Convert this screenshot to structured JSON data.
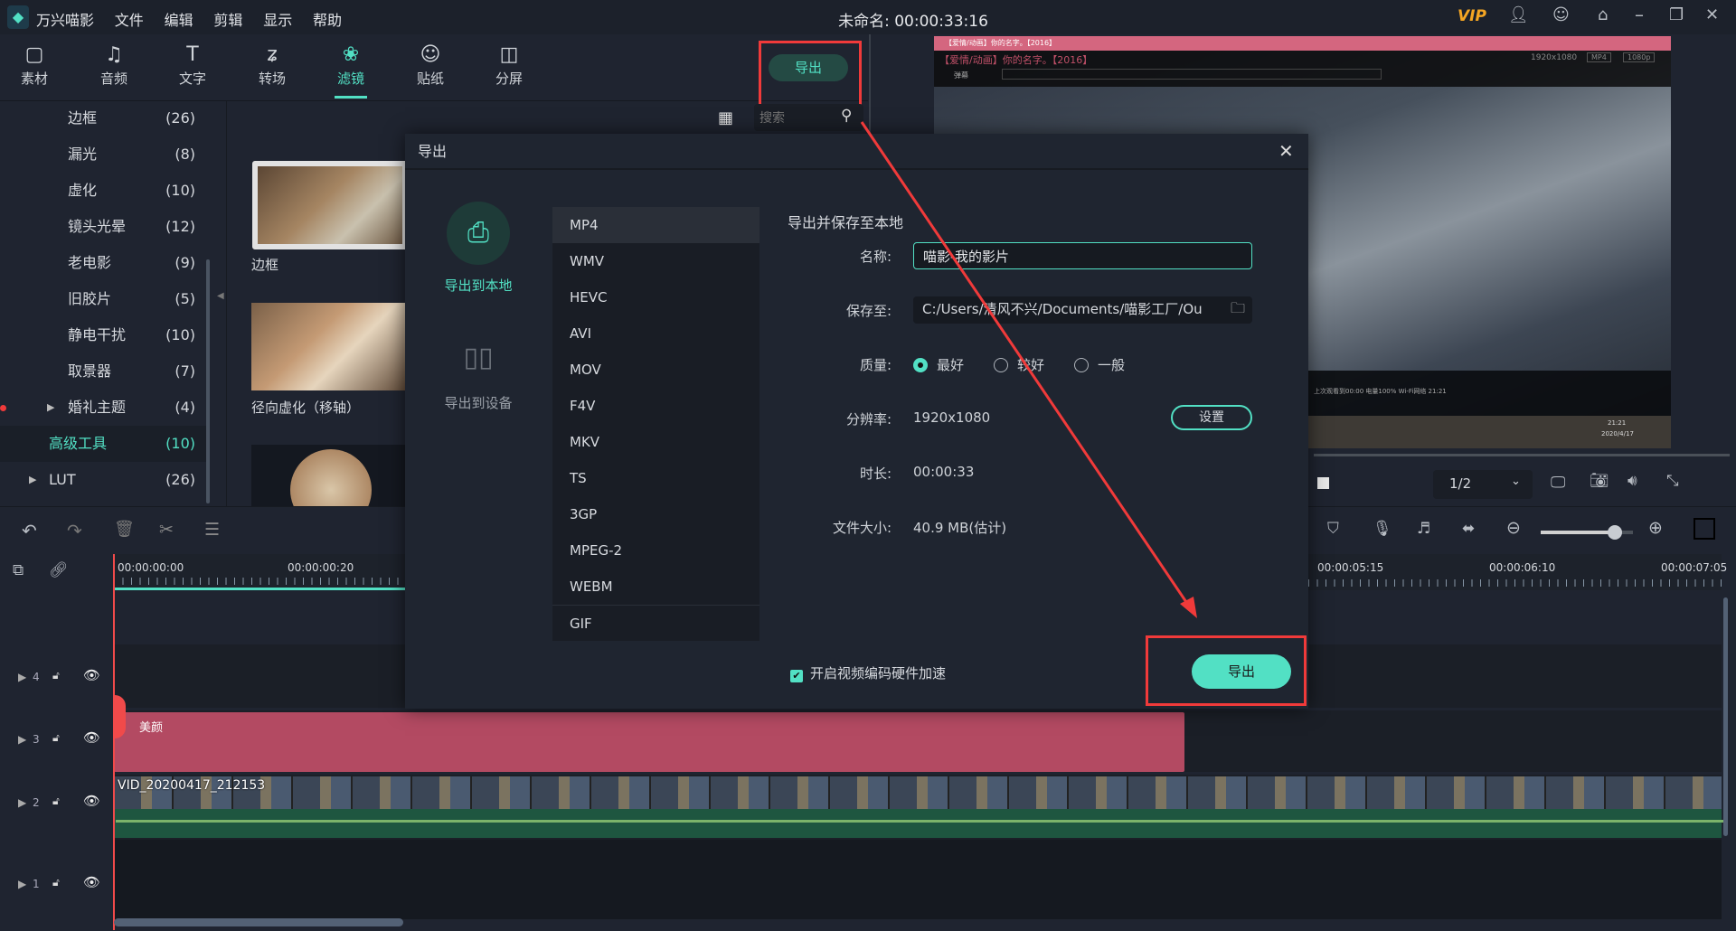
{
  "app": {
    "name": "万兴喵影",
    "menu": [
      "文件",
      "编辑",
      "剪辑",
      "显示",
      "帮助"
    ],
    "title": "未命名: 00:00:33:16",
    "vip": "VIP"
  },
  "tabs": [
    {
      "label": "素材",
      "icon": "media-icon"
    },
    {
      "label": "音频",
      "icon": "music-icon"
    },
    {
      "label": "文字",
      "icon": "text-icon"
    },
    {
      "label": "转场",
      "icon": "transition-icon"
    },
    {
      "label": "滤镜",
      "icon": "filter-icon",
      "active": true
    },
    {
      "label": "贴纸",
      "icon": "sticker-icon"
    },
    {
      "label": "分屏",
      "icon": "splitscreen-icon"
    }
  ],
  "export_top": "导出",
  "search": {
    "placeholder": "搜索"
  },
  "categories": [
    {
      "name": "边框",
      "count": "(26)"
    },
    {
      "name": "漏光",
      "count": "(8)"
    },
    {
      "name": "虚化",
      "count": "(10)"
    },
    {
      "name": "镜头光晕",
      "count": "(12)"
    },
    {
      "name": "老电影",
      "count": "(9)"
    },
    {
      "name": "旧胶片",
      "count": "(5)"
    },
    {
      "name": "静电干扰",
      "count": "(10)"
    },
    {
      "name": "取景器",
      "count": "(7)"
    },
    {
      "name": "婚礼主题",
      "count": "(4)",
      "expandable": true
    },
    {
      "name": "高级工具",
      "count": "(10)",
      "selected": true
    },
    {
      "name": "LUT",
      "count": "(26)",
      "expandable": true
    }
  ],
  "thumbs": [
    {
      "label": "边框"
    },
    {
      "label": "径向虚化（移轴）"
    }
  ],
  "preview": {
    "video_title": "【爱情/动画】你的名字。【2016】",
    "resolution": "1920x1080",
    "format": "MP4",
    "quality": "1080p",
    "danmaku": "弹幕",
    "status": "上次观看到00:00 电量100% Wi-Fi网络 21:21",
    "clock_time": "21:21",
    "clock_date": "2020/4/17",
    "page": "1/2"
  },
  "dialog": {
    "title": "导出",
    "targets": [
      {
        "label": "导出到本地",
        "active": true
      },
      {
        "label": "导出到设备"
      }
    ],
    "formats": [
      "MP4",
      "WMV",
      "HEVC",
      "AVI",
      "MOV",
      "F4V",
      "MKV",
      "TS",
      "3GP",
      "MPEG-2",
      "WEBM",
      "GIF"
    ],
    "selected_format": "MP4",
    "heading": "导出并保存至本地",
    "name_label": "名称:",
    "name_value": "喵影-我的影片",
    "save_label": "保存至:",
    "save_value": "C:/Users/清风不兴/Documents/喵影工厂/Ou",
    "quality_label": "质量:",
    "quality_options": [
      "最好",
      "较好",
      "一般"
    ],
    "quality_selected": "最好",
    "res_label": "分辨率:",
    "res_value": "1920x1080",
    "settings_btn": "设置",
    "dur_label": "时长:",
    "dur_value": "00:00:33",
    "size_label": "文件大小:",
    "size_value": "40.9 MB(估计)",
    "hw_accel": "开启视频编码硬件加速",
    "hw_accel_checked": true,
    "export_btn": "导出"
  },
  "timeline": {
    "ruler_left": [
      "00:00:00:00",
      "00:00:00:20"
    ],
    "ruler_right": [
      "00:00:05:15",
      "00:00:06:10",
      "00:00:07:05"
    ],
    "tracks": [
      "4",
      "3",
      "2",
      "1"
    ],
    "effect_clip": "美颜",
    "video_clip": "VID_20200417_212153",
    "zoom_level": 0.8
  },
  "colors": {
    "accent": "#52e0c4",
    "annotation": "#f03a3a",
    "effect_clip": "#b34a62",
    "audio": "#1e5640"
  }
}
